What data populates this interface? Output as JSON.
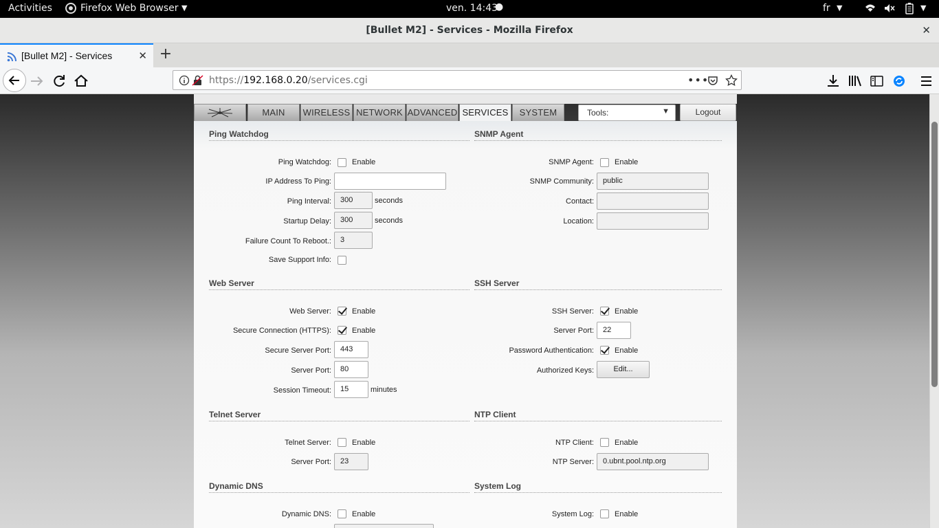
{
  "gnome": {
    "activities": "Activities",
    "app_menu": "Firefox Web Browser",
    "clock": "ven. 14:43",
    "lang": "fr"
  },
  "window": {
    "title": "[Bullet M2] - Services - Mozilla Firefox"
  },
  "browser": {
    "tab_title": "[Bullet M2] - Services",
    "url_prefix": "https://",
    "url_host": "192.168.0.20",
    "url_path": "/services.cgi"
  },
  "nav_tabs": [
    "MAIN",
    "WIRELESS",
    "NETWORK",
    "ADVANCED",
    "SERVICES",
    "SYSTEM"
  ],
  "tools_select": "Tools:",
  "logout": "Logout",
  "ping": {
    "title": "Ping Watchdog",
    "watchdog_label": "Ping Watchdog:",
    "enable": "Enable",
    "ip_label": "IP Address To Ping:",
    "ip_value": "",
    "interval_label": "Ping Interval:",
    "interval_value": "300",
    "delay_label": "Startup Delay:",
    "delay_value": "300",
    "seconds": "seconds",
    "failure_label": "Failure Count To Reboot.:",
    "failure_value": "3",
    "support_label": "Save Support Info:"
  },
  "snmp": {
    "title": "SNMP Agent",
    "agent_label": "SNMP Agent:",
    "enable": "Enable",
    "community_label": "SNMP Community:",
    "community_value": "public",
    "contact_label": "Contact:",
    "contact_value": "",
    "location_label": "Location:",
    "location_value": ""
  },
  "web": {
    "title": "Web Server",
    "server_label": "Web Server:",
    "enable": "Enable",
    "https_label": "Secure Connection (HTTPS):",
    "secure_port_label": "Secure Server Port:",
    "secure_port_value": "443",
    "port_label": "Server Port:",
    "port_value": "80",
    "timeout_label": "Session Timeout:",
    "timeout_value": "15",
    "minutes": "minutes"
  },
  "ssh": {
    "title": "SSH Server",
    "server_label": "SSH Server:",
    "enable": "Enable",
    "port_label": "Server Port:",
    "port_value": "22",
    "password_label": "Password Authentication:",
    "keys_label": "Authorized Keys:",
    "edit": "Edit..."
  },
  "telnet": {
    "title": "Telnet Server",
    "server_label": "Telnet Server:",
    "enable": "Enable",
    "port_label": "Server Port:",
    "port_value": "23"
  },
  "ntp": {
    "title": "NTP Client",
    "client_label": "NTP Client:",
    "enable": "Enable",
    "server_label": "NTP Server:",
    "server_value": "0.ubnt.pool.ntp.org"
  },
  "ddns": {
    "title": "Dynamic DNS",
    "label": "Dynamic DNS:",
    "enable": "Enable"
  },
  "syslog": {
    "title": "System Log",
    "label": "System Log:",
    "enable": "Enable"
  },
  "colors": {
    "firefox_accent": "#0a84ff",
    "topbar": "#000000"
  }
}
